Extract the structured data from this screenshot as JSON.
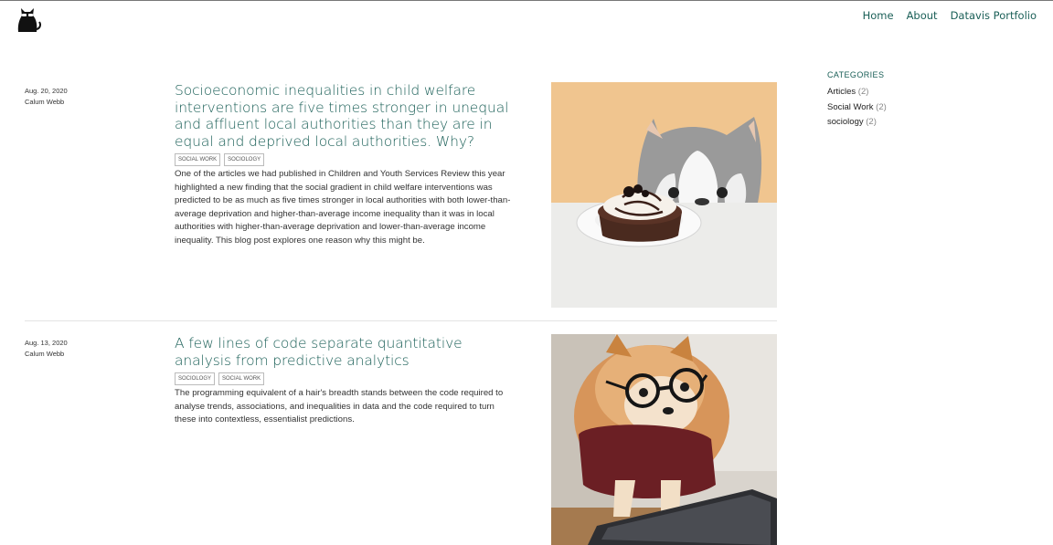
{
  "nav": {
    "items": [
      "Home",
      "About",
      "Datavis Portfolio"
    ]
  },
  "logo": {
    "icon": "cat-logo-icon"
  },
  "posts": [
    {
      "date": "Aug. 20, 2020",
      "author": "Calum Webb",
      "title": "Socioeconomic inequalities in child welfare interventions are five times stronger in unequal and affluent local authorities than they are in equal and deprived local authorities. Why?",
      "tags": [
        "SOCIAL WORK",
        "SOCIOLOGY"
      ],
      "summary": "One of the articles we had published in Children and Youth Services Review this year highlighted a new finding that the social gradient in child welfare interventions was predicted to be as much as five times stronger in local authorities with both lower-than-average deprivation and higher-than-average income inequality than it was in local authorities with higher-than-average deprivation and lower-than-average income inequality. This blog post explores one reason why this might be.",
      "image": "husky-dog-with-cake-photo"
    },
    {
      "date": "Aug. 13, 2020",
      "author": "Calum Webb",
      "title": "A few lines of code separate quantitative analysis from predictive analytics",
      "tags": [
        "SOCIOLOGY",
        "SOCIAL WORK"
      ],
      "summary": "The programming equivalent of a hair's breadth stands between the code required to analyse trends, associations, and inequalities in data and the code required to turn these into contextless, essentialist predictions.",
      "image": "pomeranian-with-glasses-photo"
    }
  ],
  "sidebar": {
    "heading": "CATEGORIES",
    "categories": [
      {
        "name": "Articles",
        "count": "(2)"
      },
      {
        "name": "Social Work",
        "count": "(2)"
      },
      {
        "name": "sociology",
        "count": "(2)"
      }
    ]
  },
  "colors": {
    "accent": "#1a5f57"
  }
}
